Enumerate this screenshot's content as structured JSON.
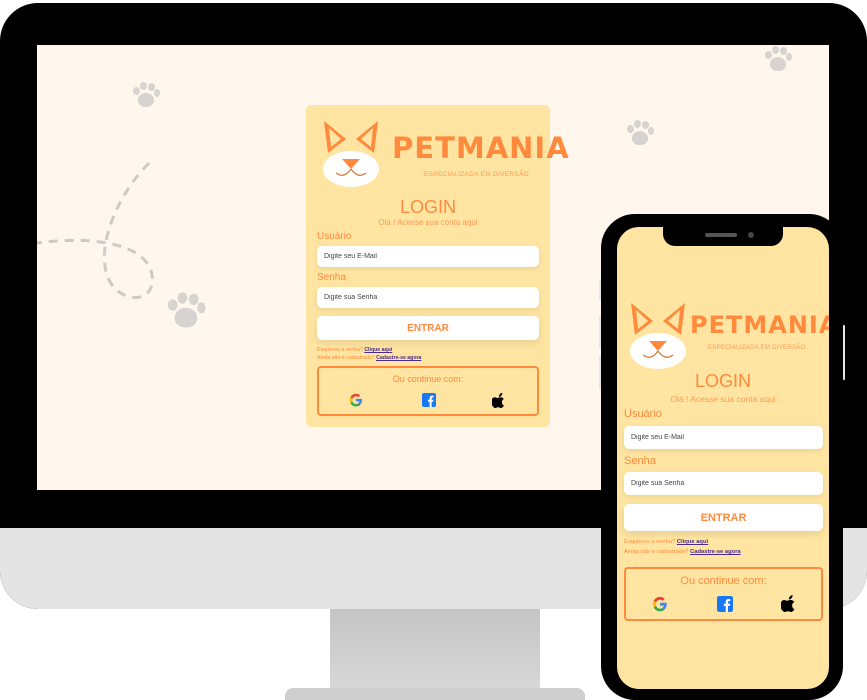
{
  "brand": {
    "name": "PETMANIA",
    "tagline": "ESPECIALIZADA EM DIVERSÃO"
  },
  "login": {
    "title": "LOGIN",
    "subtitle": "Olá ! Acesse sua conta aqui",
    "user_label": "Usuário",
    "user_placeholder": "Digite seu E-Mail",
    "password_label": "Senha",
    "password_placeholder": "Digite sua Senha",
    "submit_label": "ENTRAR",
    "forgot_text": "Esqueceu a senha?",
    "forgot_link": "Clique aqui",
    "signup_text": "Ainda não é cadastrado?",
    "signup_link": "Cadastre-se agora",
    "social_title": "Ou continue com:"
  },
  "icons": {
    "google": "google-icon",
    "facebook": "facebook-icon",
    "apple": "apple-icon",
    "paw": "paw-print-icon",
    "cat": "cat-face-logo"
  },
  "colors": {
    "accent": "#ff8a3d",
    "card_bg": "#ffe5a1",
    "screen_bg": "#fff6ee",
    "link": "#4a2a8c"
  }
}
